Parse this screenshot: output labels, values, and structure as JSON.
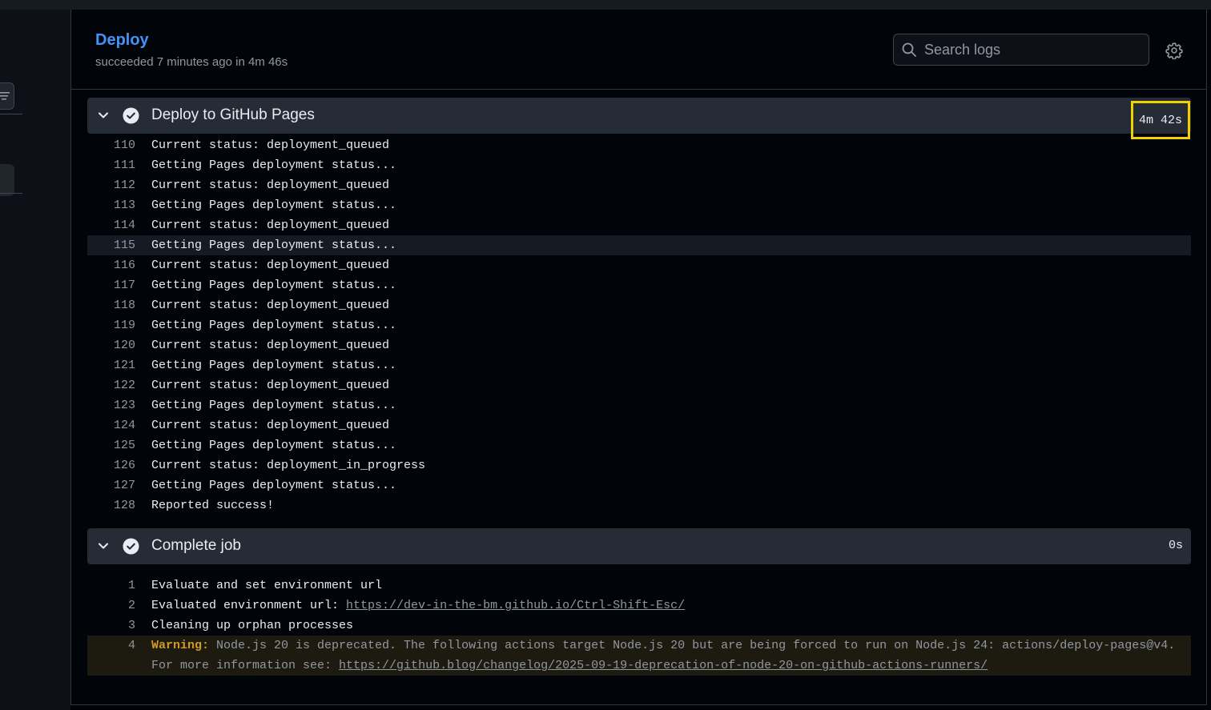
{
  "job": {
    "title": "Deploy",
    "subtitle": "succeeded 7 minutes ago in 4m 46s"
  },
  "search": {
    "placeholder": "Search logs"
  },
  "steps": [
    {
      "name": "Deploy to GitHub Pages",
      "duration": "4m 42s",
      "lines": [
        {
          "n": "110",
          "text": "Current status: deployment_queued"
        },
        {
          "n": "111",
          "text": "Getting Pages deployment status..."
        },
        {
          "n": "112",
          "text": "Current status: deployment_queued"
        },
        {
          "n": "113",
          "text": "Getting Pages deployment status..."
        },
        {
          "n": "114",
          "text": "Current status: deployment_queued"
        },
        {
          "n": "115",
          "text": "Getting Pages deployment status..."
        },
        {
          "n": "116",
          "text": "Current status: deployment_queued"
        },
        {
          "n": "117",
          "text": "Getting Pages deployment status..."
        },
        {
          "n": "118",
          "text": "Current status: deployment_queued"
        },
        {
          "n": "119",
          "text": "Getting Pages deployment status..."
        },
        {
          "n": "120",
          "text": "Current status: deployment_queued"
        },
        {
          "n": "121",
          "text": "Getting Pages deployment status..."
        },
        {
          "n": "122",
          "text": "Current status: deployment_queued"
        },
        {
          "n": "123",
          "text": "Getting Pages deployment status..."
        },
        {
          "n": "124",
          "text": "Current status: deployment_queued"
        },
        {
          "n": "125",
          "text": "Getting Pages deployment status..."
        },
        {
          "n": "126",
          "text": "Current status: deployment_in_progress"
        },
        {
          "n": "127",
          "text": "Getting Pages deployment status..."
        },
        {
          "n": "128",
          "text": "Reported success!"
        }
      ]
    },
    {
      "name": "Complete job",
      "duration": "0s",
      "lines": [
        {
          "n": "1",
          "text": "Evaluate and set environment url"
        },
        {
          "n": "2",
          "prefix": "Evaluated environment url: ",
          "link": "https://dev-in-the-bm.github.io/Ctrl-Shift-Esc/"
        },
        {
          "n": "3",
          "text": "Cleaning up orphan processes"
        },
        {
          "n": "4",
          "warning_label": "Warning:",
          "warning_text": " Node.js 20 is deprecated. The following actions target Node.js 20 but are being forced to run on Node.js 24: actions/deploy-pages@v4.",
          "cont_prefix": "For more information see: ",
          "cont_link": "https://github.blog/changelog/2025-09-19-deprecation-of-node-20-on-github-actions-runners/"
        }
      ]
    }
  ],
  "colors": {
    "accent": "#4493f8",
    "warning": "#d29922",
    "highlight_box": "#f0d200"
  }
}
